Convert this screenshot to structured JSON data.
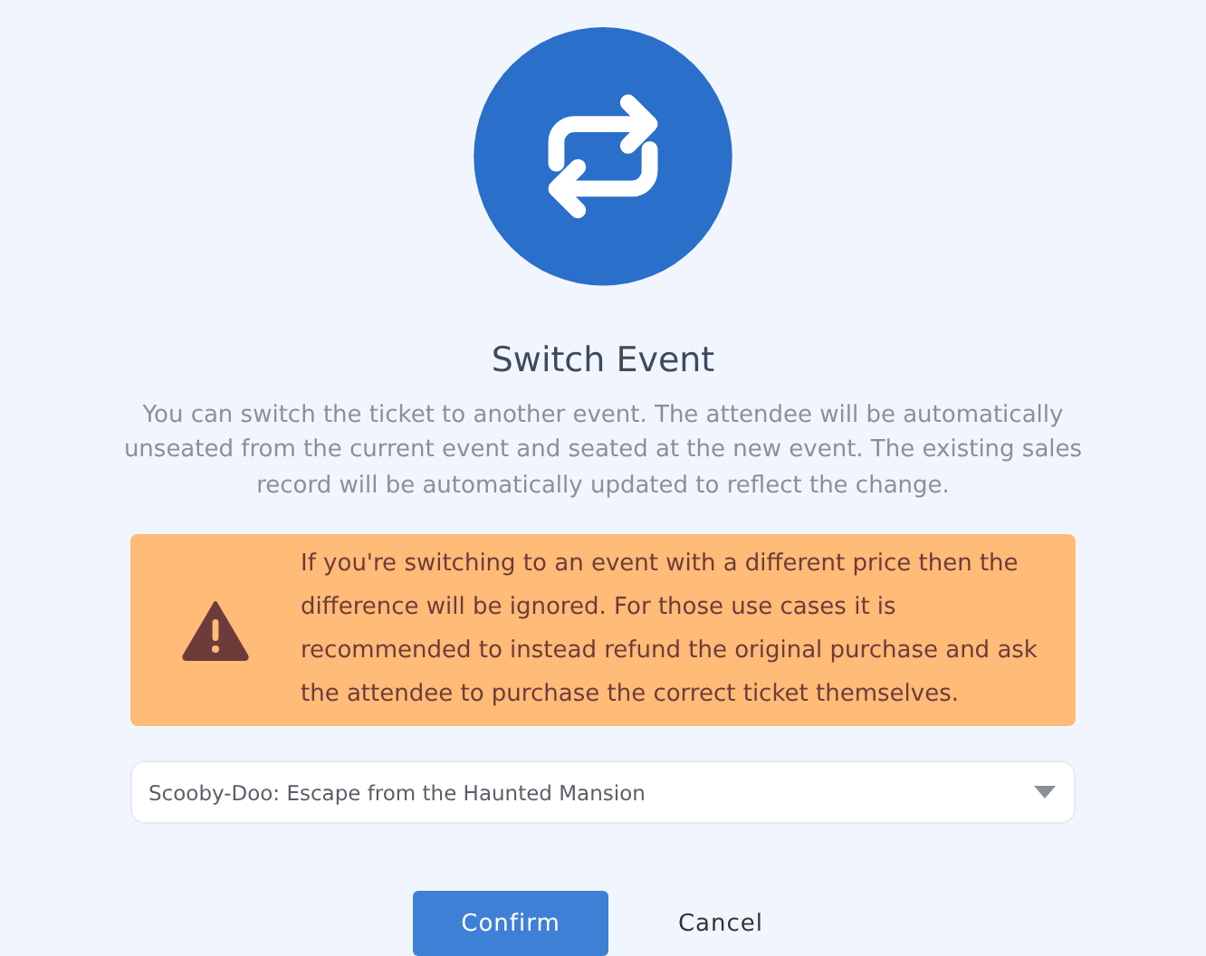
{
  "title": "Switch Event",
  "description": "You can switch the ticket to another event. The attendee will be automatically unseated from the current event and seated at the new event. The existing sales record will be automatically updated to reflect the change.",
  "warning": {
    "text": "If you're switching to an event with a different price then the difference will be ignored. For those use cases it is recommended to instead refund the original purchase and ask the attendee to purchase the correct ticket themselves."
  },
  "event_select": {
    "value": "Scooby-Doo: Escape from the Haunted Mansion"
  },
  "buttons": [
    {
      "label": "Confirm",
      "kind": "primary"
    },
    {
      "label": "Cancel",
      "kind": "plain"
    }
  ]
}
